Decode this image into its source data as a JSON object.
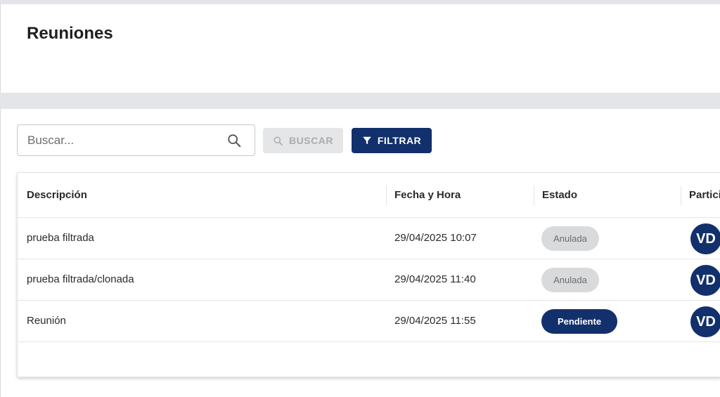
{
  "header": {
    "title": "Reuniones"
  },
  "toolbar": {
    "search_placeholder": "Buscar...",
    "search_button_label": "BUSCAR",
    "filter_button_label": "FILTRAR"
  },
  "table": {
    "columns": [
      "Descripción",
      "Fecha y Hora",
      "Estado",
      "Partici"
    ],
    "rows": [
      {
        "descripcion": "prueba filtrada",
        "fecha": "29/04/2025 10:07",
        "estado": "Anulada",
        "participante": "VD"
      },
      {
        "descripcion": "prueba filtrada/clonada",
        "fecha": "29/04/2025 11:40",
        "estado": "Anulada",
        "participante": "VD"
      },
      {
        "descripcion": "Reunión",
        "fecha": "29/04/2025 11:55",
        "estado": "Pendiente",
        "participante": "VD"
      }
    ]
  },
  "colors": {
    "primary": "#12306b",
    "disabled_bg": "#e4e6e8",
    "anulada_bg": "#d9dadc"
  }
}
